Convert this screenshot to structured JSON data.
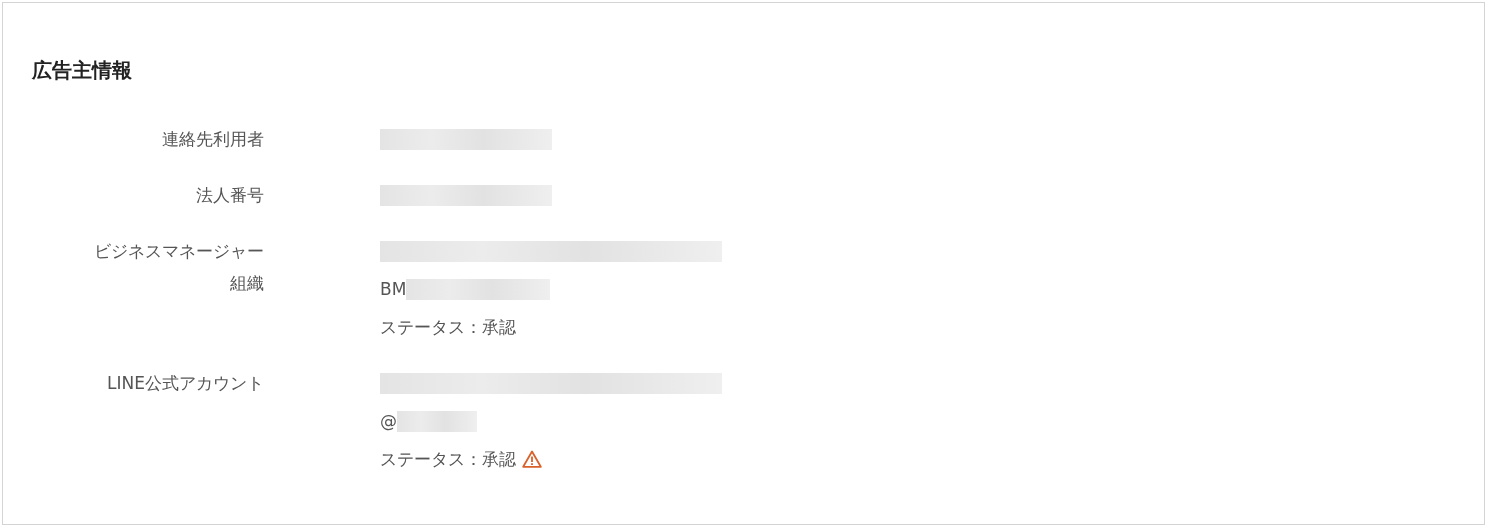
{
  "title": "広告主情報",
  "fields": [
    {
      "label": "連絡先利用者",
      "lines": [
        {
          "kind": "redacted"
        }
      ]
    },
    {
      "label": "法人番号",
      "lines": [
        {
          "kind": "redacted"
        }
      ]
    },
    {
      "label": "ビジネスマネージャー組織",
      "lines": [
        {
          "kind": "redacted"
        },
        {
          "kind": "prefixed",
          "prefix": "BM"
        },
        {
          "kind": "status",
          "text": "ステータス：承認",
          "warning": false
        }
      ]
    },
    {
      "label": "LINE公式アカウント",
      "lines": [
        {
          "kind": "redacted"
        },
        {
          "kind": "prefixed",
          "prefix": "@"
        },
        {
          "kind": "status",
          "text": "ステータス：承認",
          "warning": true
        }
      ]
    }
  ]
}
